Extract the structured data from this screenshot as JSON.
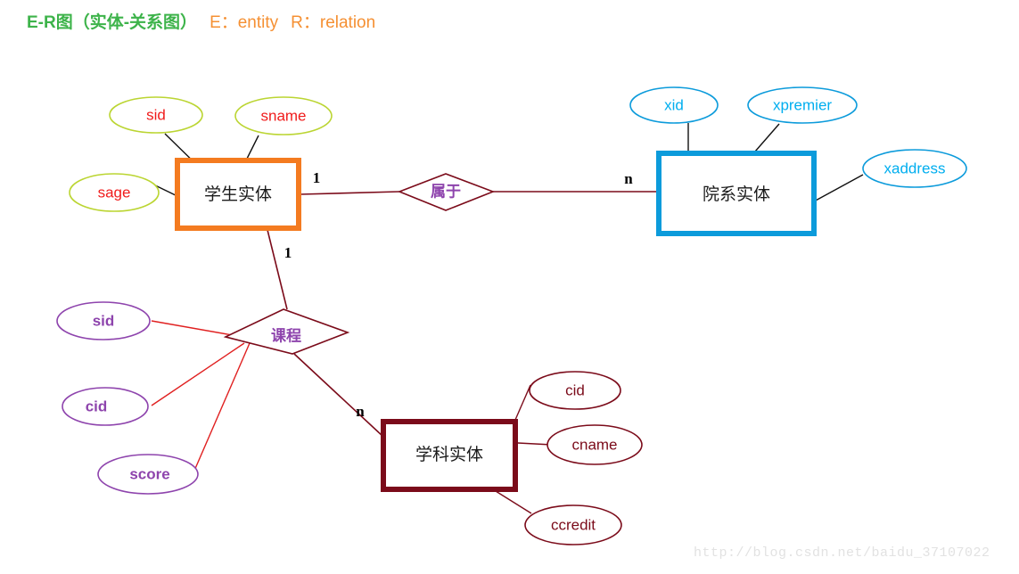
{
  "title": {
    "main": "E-R图（实体-关系图）",
    "legend_e": "E：entity",
    "legend_r": "R：relation",
    "main_color": "#3DB34A",
    "legend_color": "#F59033"
  },
  "watermark": "http://blog.csdn.net/baidu_37107022",
  "colors": {
    "student_entity_border": "#F47B20",
    "student_attr_stroke": "#BBD532",
    "student_attr_text": "#F01C1C",
    "dept_entity_border": "#0C9BDB",
    "dept_attr_stroke": "#0C9BDB",
    "dept_attr_text": "#00AEEF",
    "subject_entity_border": "#7B0B1A",
    "subject_attr_stroke": "#7B0B1A",
    "subject_attr_text": "#7B0B1A",
    "course_attr_stroke": "#8E44AD",
    "course_attr_text": "#8E44AD",
    "relation_border": "#7B0B1A",
    "relation_text": "#8E44AD",
    "connector_dark": "#111111",
    "connector_red": "#E02020",
    "connector_maroon": "#7B0B1A"
  },
  "entities": [
    {
      "name": "student-entity",
      "label": "学生实体"
    },
    {
      "name": "department-entity",
      "label": "院系实体"
    },
    {
      "name": "subject-entity",
      "label": "学科实体"
    }
  ],
  "relations": [
    {
      "name": "belongs-to-relation",
      "label": "属于"
    },
    {
      "name": "course-relation",
      "label": "课程"
    }
  ],
  "attributes": {
    "student": [
      {
        "name": "attribute-sid",
        "label": "sid"
      },
      {
        "name": "attribute-sname",
        "label": "sname"
      },
      {
        "name": "attribute-sage",
        "label": "sage"
      }
    ],
    "department": [
      {
        "name": "attribute-xid",
        "label": "xid"
      },
      {
        "name": "attribute-xpremier",
        "label": "xpremier"
      },
      {
        "name": "attribute-xaddress",
        "label": "xaddress"
      }
    ],
    "course_relation": [
      {
        "name": "attribute-course-sid",
        "label": "sid"
      },
      {
        "name": "attribute-course-cid",
        "label": "cid"
      },
      {
        "name": "attribute-course-score",
        "label": "score"
      }
    ],
    "subject": [
      {
        "name": "attribute-cid",
        "label": "cid"
      },
      {
        "name": "attribute-cname",
        "label": "cname"
      },
      {
        "name": "attribute-ccredit",
        "label": "ccredit"
      }
    ]
  },
  "cardinalities": [
    {
      "name": "cardinality-student-belongs",
      "label": "1"
    },
    {
      "name": "cardinality-dept-belongs",
      "label": "n"
    },
    {
      "name": "cardinality-student-course",
      "label": "1"
    },
    {
      "name": "cardinality-subject-course",
      "label": "n"
    }
  ]
}
